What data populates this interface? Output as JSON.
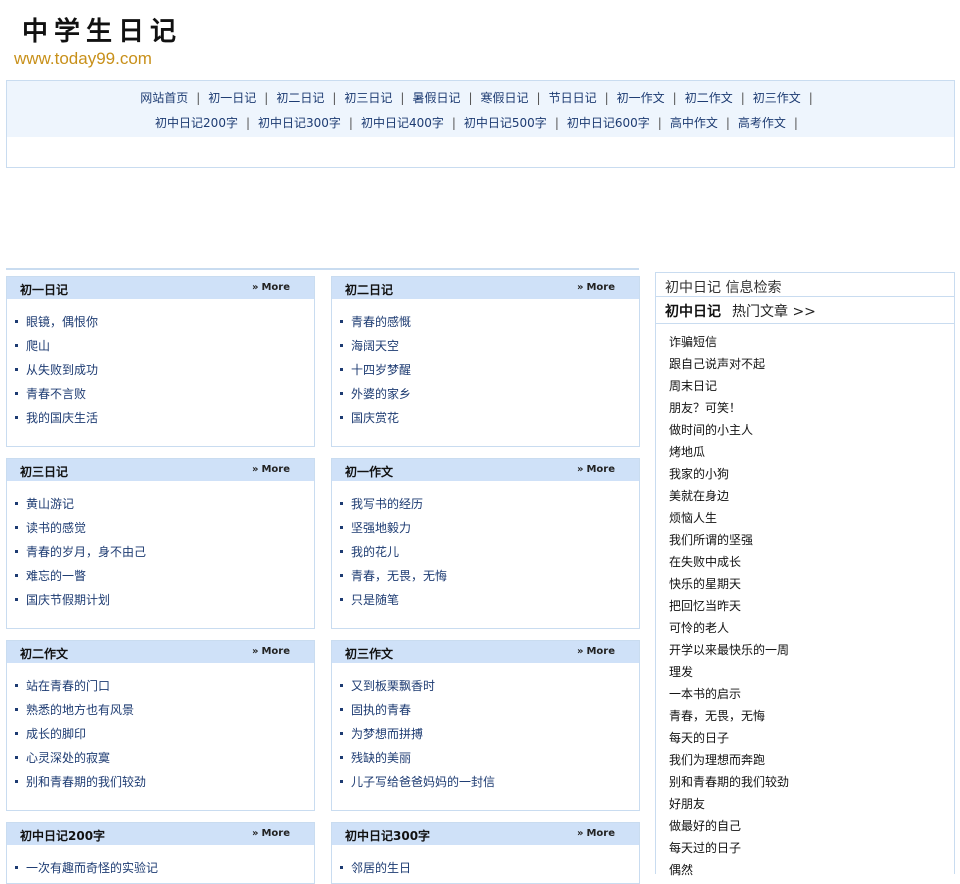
{
  "site": {
    "logo_title": "中学生日记",
    "logo_url": "www.today99.com"
  },
  "nav": {
    "row1": [
      "网站首页",
      "初一日记",
      "初二日记",
      "初三日记",
      "暑假日记",
      "寒假日记",
      "节日日记",
      "初一作文",
      "初二作文",
      "初三作文"
    ],
    "row2": [
      "初中日记200字",
      "初中日记300字",
      "初中日记400字",
      "初中日记500字",
      "初中日记600字",
      "高中作文",
      "高考作文"
    ],
    "separator": "|"
  },
  "more_label": "More",
  "sections": [
    {
      "title": "初一日记",
      "items": [
        "眼镜，偶恨你",
        "爬山",
        "从失败到成功",
        "青春不言败",
        "我的国庆生活"
      ]
    },
    {
      "title": "初二日记",
      "items": [
        "青春的感慨",
        "海阔天空",
        "十四岁梦醒",
        "外婆的家乡",
        "国庆赏花"
      ]
    },
    {
      "title": "初三日记",
      "items": [
        "黄山游记",
        "读书的感觉",
        "青春的岁月，身不由己",
        "难忘的一瞥",
        "国庆节假期计划"
      ]
    },
    {
      "title": "初一作文",
      "items": [
        "我写书的经历",
        "坚强地毅力",
        "我的花儿",
        "青春，无畏，无悔",
        "只是随笔"
      ]
    },
    {
      "title": "初二作文",
      "items": [
        "站在青春的门口",
        "熟悉的地方也有风景",
        "成长的脚印",
        "心灵深处的寂寞",
        "别和青春期的我们较劲"
      ]
    },
    {
      "title": "初三作文",
      "items": [
        "又到板栗飘香时",
        "固执的青春",
        "为梦想而拼搏",
        "残缺的美丽",
        "儿子写给爸爸妈妈的一封信"
      ]
    },
    {
      "title": "初中日记200字",
      "items": [
        "一次有趣而奇怪的实验记"
      ]
    },
    {
      "title": "初中日记300字",
      "items": [
        "邻居的生日"
      ]
    }
  ],
  "sidebar": {
    "search_title": "初中日记  信息检索",
    "hot_title_bold": "初中日记",
    "hot_title_rest": "热门文章 >>",
    "items": [
      "诈骗短信",
      "跟自己说声对不起",
      "周末日记",
      "朋友？可笑！",
      "做时间的小主人",
      "烤地瓜",
      "我家的小狗",
      "美就在身边",
      "烦恼人生",
      "我们所谓的坚强",
      "在失败中成长",
      "快乐的星期天",
      "把回忆当昨天",
      "可怜的老人",
      "开学以来最快乐的一周",
      "理发",
      "一本书的启示",
      "青春，无畏，无悔",
      "每天的日子",
      "我们为理想而奔跑",
      "别和青春期的我们较劲",
      "好朋友",
      "做最好的自己",
      "每天过的日子",
      "偶然"
    ]
  }
}
